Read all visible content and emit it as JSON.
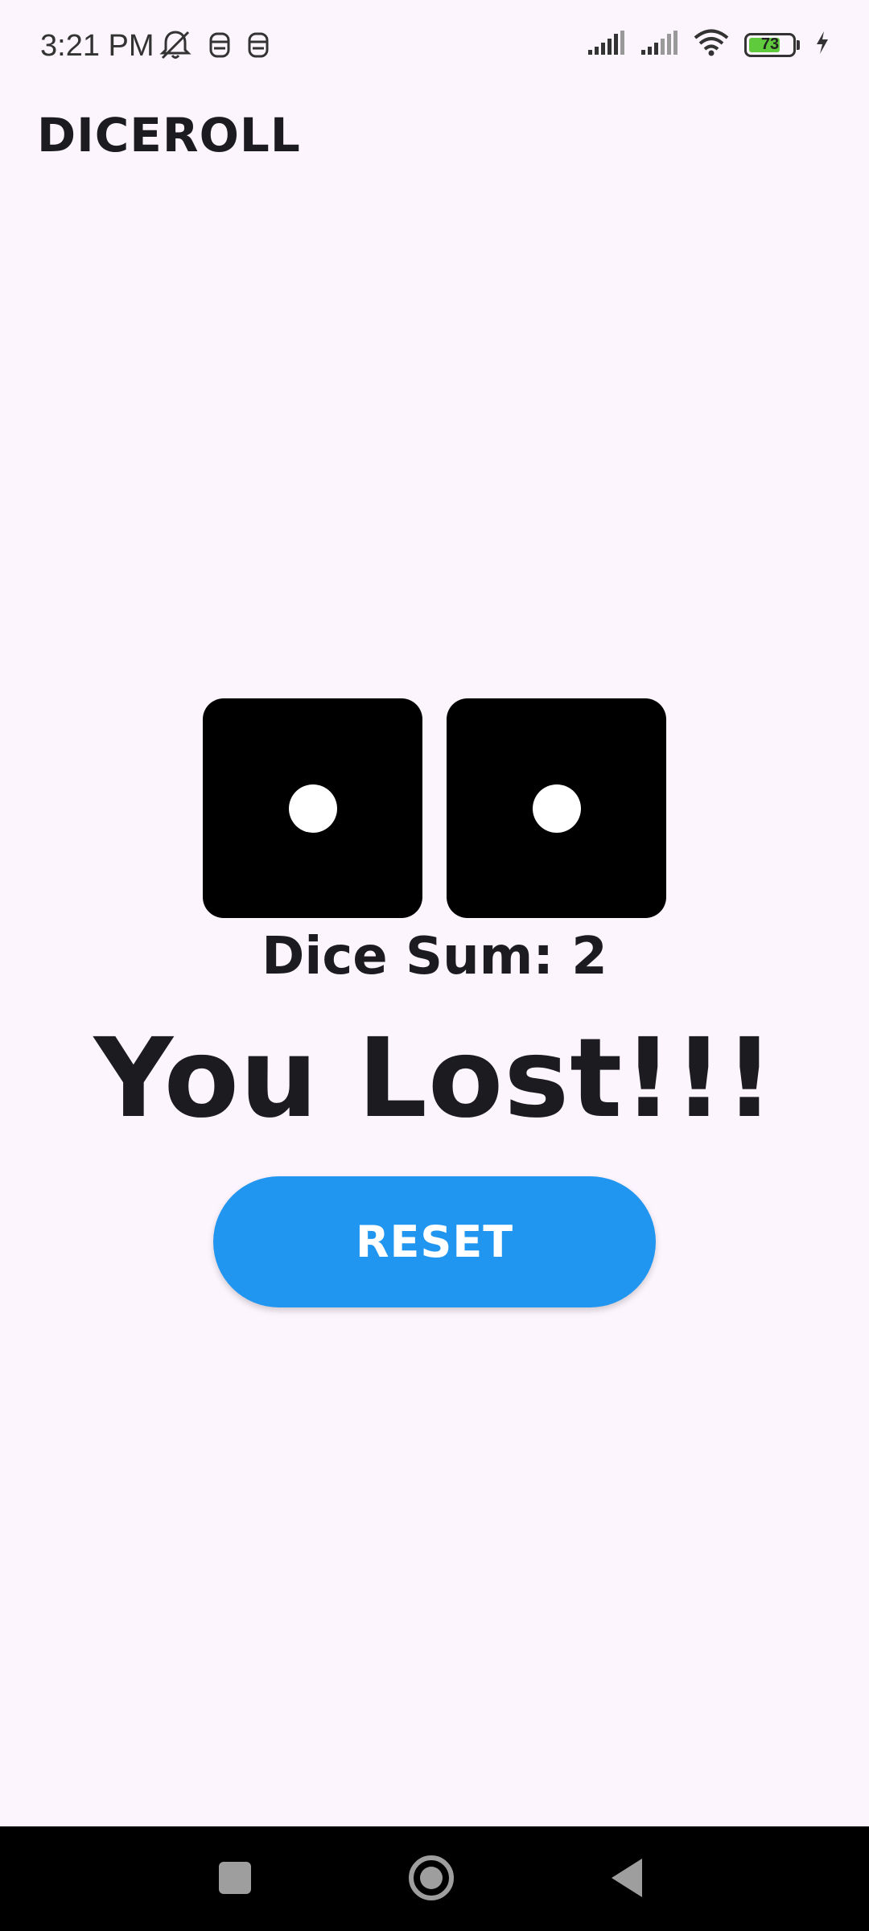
{
  "status_bar": {
    "time": "3:21 PM",
    "battery_level": "73",
    "battery_fraction": 0.73,
    "icons": [
      "notifications-off-icon",
      "app-notification-icon",
      "app-notification-icon",
      "cellular-signal-icon",
      "cellular-signal-icon",
      "wifi-icon",
      "battery-icon",
      "charging-icon"
    ]
  },
  "app": {
    "title": "DICEROLL"
  },
  "dice": [
    {
      "value": 1
    },
    {
      "value": 1
    }
  ],
  "dice_sum_text": "Dice Sum: 2",
  "result_text": "You Lost!!!",
  "reset_label": "RESET",
  "nav": {
    "icons": [
      "recents-icon",
      "home-icon",
      "back-icon"
    ]
  },
  "colors": {
    "background": "#FDF5FD",
    "button": "#2196F0",
    "die": "#000000",
    "pip": "#FFFFFF",
    "battery": "#5FCB3C"
  }
}
